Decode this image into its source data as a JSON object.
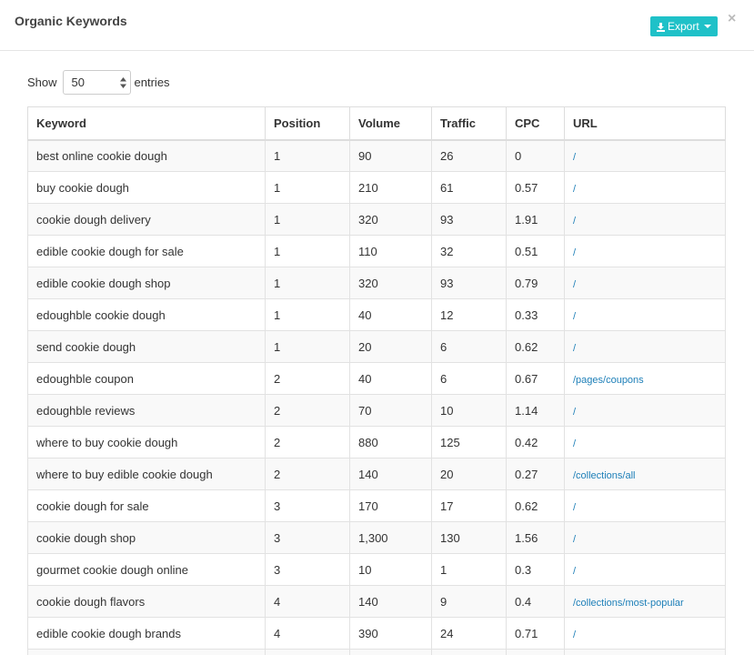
{
  "header": {
    "title": "Organic Keywords",
    "export_label": "Export",
    "close_label": "×"
  },
  "length": {
    "show_label": "Show",
    "value": "50",
    "entries_label": "entries"
  },
  "table": {
    "columns": [
      "Keyword",
      "Position",
      "Volume",
      "Traffic",
      "CPC",
      "URL"
    ],
    "rows": [
      {
        "keyword": "best online cookie dough",
        "position": "1",
        "volume": "90",
        "traffic": "26",
        "cpc": "0",
        "url": "/"
      },
      {
        "keyword": "buy cookie dough",
        "position": "1",
        "volume": "210",
        "traffic": "61",
        "cpc": "0.57",
        "url": "/"
      },
      {
        "keyword": "cookie dough delivery",
        "position": "1",
        "volume": "320",
        "traffic": "93",
        "cpc": "1.91",
        "url": "/"
      },
      {
        "keyword": "edible cookie dough for sale",
        "position": "1",
        "volume": "110",
        "traffic": "32",
        "cpc": "0.51",
        "url": "/"
      },
      {
        "keyword": "edible cookie dough shop",
        "position": "1",
        "volume": "320",
        "traffic": "93",
        "cpc": "0.79",
        "url": "/"
      },
      {
        "keyword": "edoughble cookie dough",
        "position": "1",
        "volume": "40",
        "traffic": "12",
        "cpc": "0.33",
        "url": "/"
      },
      {
        "keyword": "send cookie dough",
        "position": "1",
        "volume": "20",
        "traffic": "6",
        "cpc": "0.62",
        "url": "/"
      },
      {
        "keyword": "edoughble coupon",
        "position": "2",
        "volume": "40",
        "traffic": "6",
        "cpc": "0.67",
        "url": "/pages/coupons"
      },
      {
        "keyword": "edoughble reviews",
        "position": "2",
        "volume": "70",
        "traffic": "10",
        "cpc": "1.14",
        "url": "/"
      },
      {
        "keyword": "where to buy cookie dough",
        "position": "2",
        "volume": "880",
        "traffic": "125",
        "cpc": "0.42",
        "url": "/"
      },
      {
        "keyword": "where to buy edible cookie dough",
        "position": "2",
        "volume": "140",
        "traffic": "20",
        "cpc": "0.27",
        "url": "/collections/all"
      },
      {
        "keyword": "cookie dough for sale",
        "position": "3",
        "volume": "170",
        "traffic": "17",
        "cpc": "0.62",
        "url": "/"
      },
      {
        "keyword": "cookie dough shop",
        "position": "3",
        "volume": "1,300",
        "traffic": "130",
        "cpc": "1.56",
        "url": "/"
      },
      {
        "keyword": "gourmet cookie dough online",
        "position": "3",
        "volume": "10",
        "traffic": "1",
        "cpc": "0.3",
        "url": "/"
      },
      {
        "keyword": "cookie dough flavors",
        "position": "4",
        "volume": "140",
        "traffic": "9",
        "cpc": "0.4",
        "url": "/collections/most-popular"
      },
      {
        "keyword": "edible cookie dough brands",
        "position": "4",
        "volume": "390",
        "traffic": "24",
        "cpc": "0.71",
        "url": "/"
      },
      {
        "keyword": "",
        "position": "",
        "volume": "",
        "traffic": "",
        "cpc": "",
        "url": ""
      }
    ]
  },
  "colors": {
    "accent": "#1fc1c8",
    "link": "#1d7fb8",
    "stripe": "#f9f9f9",
    "border": "#dddddd"
  },
  "icons": {
    "export": "download-icon",
    "caret": "caret-down-icon",
    "close": "close-icon",
    "spinner": "select-arrows-icon"
  }
}
